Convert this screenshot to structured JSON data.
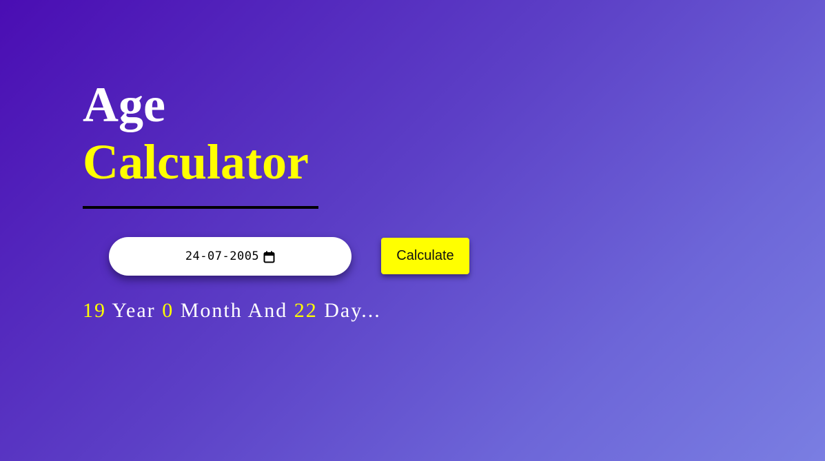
{
  "title": {
    "line1": "Age",
    "line2": "Calculator"
  },
  "form": {
    "date_value": "24-07-2005",
    "calendar_icon": "calendar-icon",
    "button_label": "Calculate"
  },
  "result": {
    "years": "19",
    "year_label": "Year",
    "months": "0",
    "month_label": "Month And",
    "days": "22",
    "day_label": "Day..."
  },
  "colors": {
    "accent": "#ffff00",
    "title_white": "#ffffff",
    "gradient_start": "#4a0db3",
    "gradient_end": "#7a7ee2"
  }
}
